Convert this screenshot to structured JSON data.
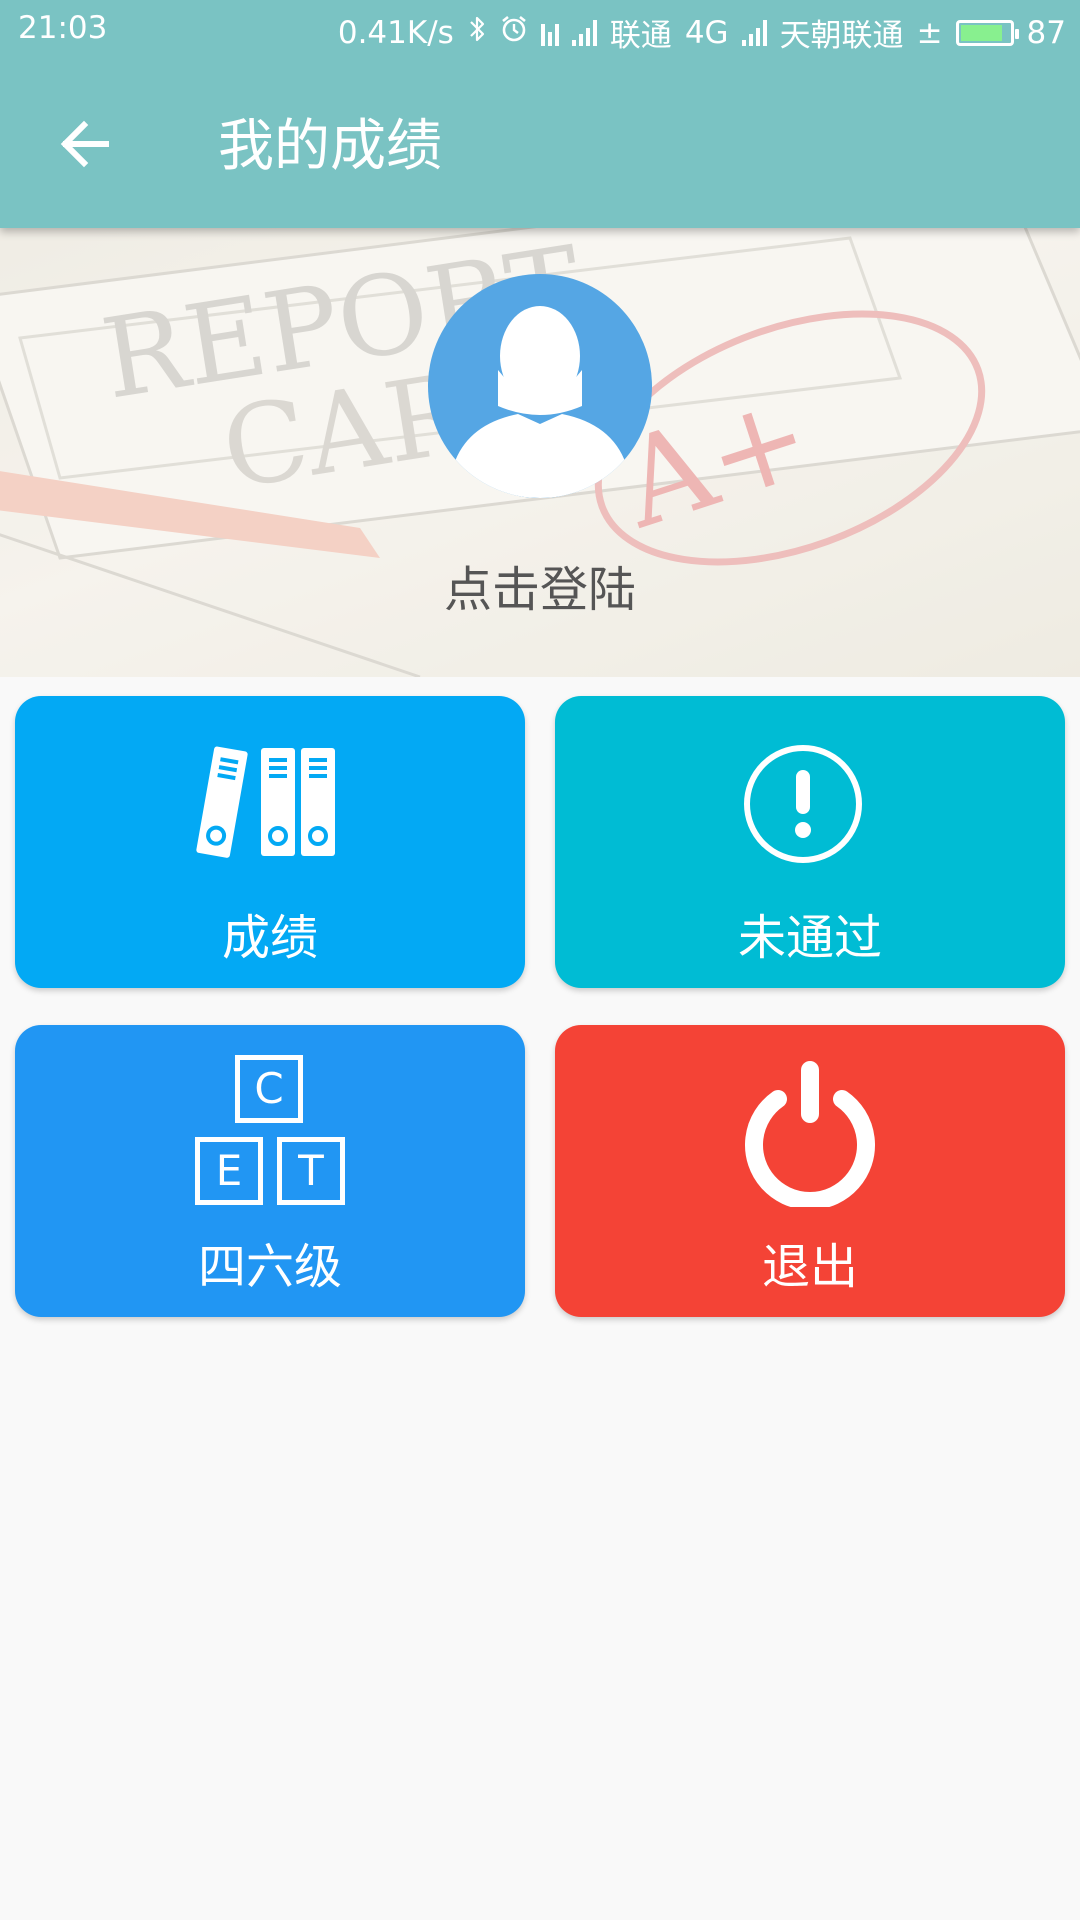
{
  "status_bar": {
    "time": "21:03",
    "net_speed": "0.41K/s",
    "carrier1": "联通",
    "network_type": "4G",
    "carrier2": "天朝联通",
    "charge_symbol": "±",
    "battery_level": "87"
  },
  "toolbar": {
    "title": "我的成绩",
    "back_icon": "arrow-left-icon"
  },
  "hero": {
    "login_text": "点击登陆",
    "avatar_icon": "user-silhouette-icon"
  },
  "tiles": [
    {
      "label": "成绩",
      "icon": "binders-icon",
      "color": "#03a9f4"
    },
    {
      "label": "未通过",
      "icon": "exclamation-circle-icon",
      "color": "#00bcd4"
    },
    {
      "label": "四六级",
      "icon": "cet-blocks-icon",
      "color": "#2196f3",
      "letters": [
        "C",
        "E",
        "T"
      ]
    },
    {
      "label": "退出",
      "icon": "power-icon",
      "color": "#f44336"
    }
  ],
  "colors": {
    "toolbar": "#7ac3c3",
    "background": "#f9f9f9"
  }
}
